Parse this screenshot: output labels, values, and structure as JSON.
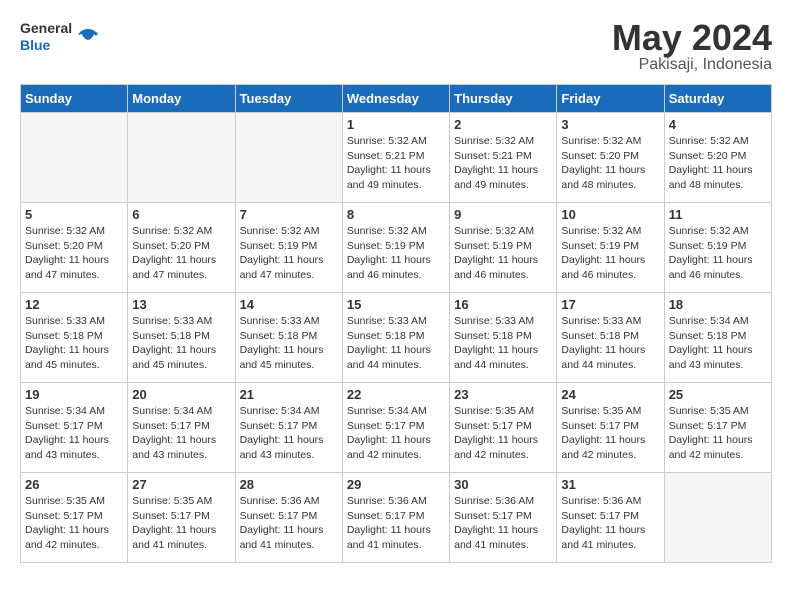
{
  "header": {
    "logo_line1": "General",
    "logo_line2": "Blue",
    "month": "May 2024",
    "location": "Pakisaji, Indonesia"
  },
  "weekdays": [
    "Sunday",
    "Monday",
    "Tuesday",
    "Wednesday",
    "Thursday",
    "Friday",
    "Saturday"
  ],
  "weeks": [
    [
      {
        "day": "",
        "info": "",
        "empty": true
      },
      {
        "day": "",
        "info": "",
        "empty": true
      },
      {
        "day": "",
        "info": "",
        "empty": true
      },
      {
        "day": "1",
        "info": "Sunrise: 5:32 AM\nSunset: 5:21 PM\nDaylight: 11 hours\nand 49 minutes."
      },
      {
        "day": "2",
        "info": "Sunrise: 5:32 AM\nSunset: 5:21 PM\nDaylight: 11 hours\nand 49 minutes."
      },
      {
        "day": "3",
        "info": "Sunrise: 5:32 AM\nSunset: 5:20 PM\nDaylight: 11 hours\nand 48 minutes."
      },
      {
        "day": "4",
        "info": "Sunrise: 5:32 AM\nSunset: 5:20 PM\nDaylight: 11 hours\nand 48 minutes."
      }
    ],
    [
      {
        "day": "5",
        "info": "Sunrise: 5:32 AM\nSunset: 5:20 PM\nDaylight: 11 hours\nand 47 minutes."
      },
      {
        "day": "6",
        "info": "Sunrise: 5:32 AM\nSunset: 5:20 PM\nDaylight: 11 hours\nand 47 minutes."
      },
      {
        "day": "7",
        "info": "Sunrise: 5:32 AM\nSunset: 5:19 PM\nDaylight: 11 hours\nand 47 minutes."
      },
      {
        "day": "8",
        "info": "Sunrise: 5:32 AM\nSunset: 5:19 PM\nDaylight: 11 hours\nand 46 minutes."
      },
      {
        "day": "9",
        "info": "Sunrise: 5:32 AM\nSunset: 5:19 PM\nDaylight: 11 hours\nand 46 minutes."
      },
      {
        "day": "10",
        "info": "Sunrise: 5:32 AM\nSunset: 5:19 PM\nDaylight: 11 hours\nand 46 minutes."
      },
      {
        "day": "11",
        "info": "Sunrise: 5:32 AM\nSunset: 5:19 PM\nDaylight: 11 hours\nand 46 minutes."
      }
    ],
    [
      {
        "day": "12",
        "info": "Sunrise: 5:33 AM\nSunset: 5:18 PM\nDaylight: 11 hours\nand 45 minutes."
      },
      {
        "day": "13",
        "info": "Sunrise: 5:33 AM\nSunset: 5:18 PM\nDaylight: 11 hours\nand 45 minutes."
      },
      {
        "day": "14",
        "info": "Sunrise: 5:33 AM\nSunset: 5:18 PM\nDaylight: 11 hours\nand 45 minutes."
      },
      {
        "day": "15",
        "info": "Sunrise: 5:33 AM\nSunset: 5:18 PM\nDaylight: 11 hours\nand 44 minutes."
      },
      {
        "day": "16",
        "info": "Sunrise: 5:33 AM\nSunset: 5:18 PM\nDaylight: 11 hours\nand 44 minutes."
      },
      {
        "day": "17",
        "info": "Sunrise: 5:33 AM\nSunset: 5:18 PM\nDaylight: 11 hours\nand 44 minutes."
      },
      {
        "day": "18",
        "info": "Sunrise: 5:34 AM\nSunset: 5:18 PM\nDaylight: 11 hours\nand 43 minutes."
      }
    ],
    [
      {
        "day": "19",
        "info": "Sunrise: 5:34 AM\nSunset: 5:17 PM\nDaylight: 11 hours\nand 43 minutes."
      },
      {
        "day": "20",
        "info": "Sunrise: 5:34 AM\nSunset: 5:17 PM\nDaylight: 11 hours\nand 43 minutes."
      },
      {
        "day": "21",
        "info": "Sunrise: 5:34 AM\nSunset: 5:17 PM\nDaylight: 11 hours\nand 43 minutes."
      },
      {
        "day": "22",
        "info": "Sunrise: 5:34 AM\nSunset: 5:17 PM\nDaylight: 11 hours\nand 42 minutes."
      },
      {
        "day": "23",
        "info": "Sunrise: 5:35 AM\nSunset: 5:17 PM\nDaylight: 11 hours\nand 42 minutes."
      },
      {
        "day": "24",
        "info": "Sunrise: 5:35 AM\nSunset: 5:17 PM\nDaylight: 11 hours\nand 42 minutes."
      },
      {
        "day": "25",
        "info": "Sunrise: 5:35 AM\nSunset: 5:17 PM\nDaylight: 11 hours\nand 42 minutes."
      }
    ],
    [
      {
        "day": "26",
        "info": "Sunrise: 5:35 AM\nSunset: 5:17 PM\nDaylight: 11 hours\nand 42 minutes."
      },
      {
        "day": "27",
        "info": "Sunrise: 5:35 AM\nSunset: 5:17 PM\nDaylight: 11 hours\nand 41 minutes."
      },
      {
        "day": "28",
        "info": "Sunrise: 5:36 AM\nSunset: 5:17 PM\nDaylight: 11 hours\nand 41 minutes."
      },
      {
        "day": "29",
        "info": "Sunrise: 5:36 AM\nSunset: 5:17 PM\nDaylight: 11 hours\nand 41 minutes."
      },
      {
        "day": "30",
        "info": "Sunrise: 5:36 AM\nSunset: 5:17 PM\nDaylight: 11 hours\nand 41 minutes."
      },
      {
        "day": "31",
        "info": "Sunrise: 5:36 AM\nSunset: 5:17 PM\nDaylight: 11 hours\nand 41 minutes."
      },
      {
        "day": "",
        "info": "",
        "empty": true
      }
    ]
  ]
}
